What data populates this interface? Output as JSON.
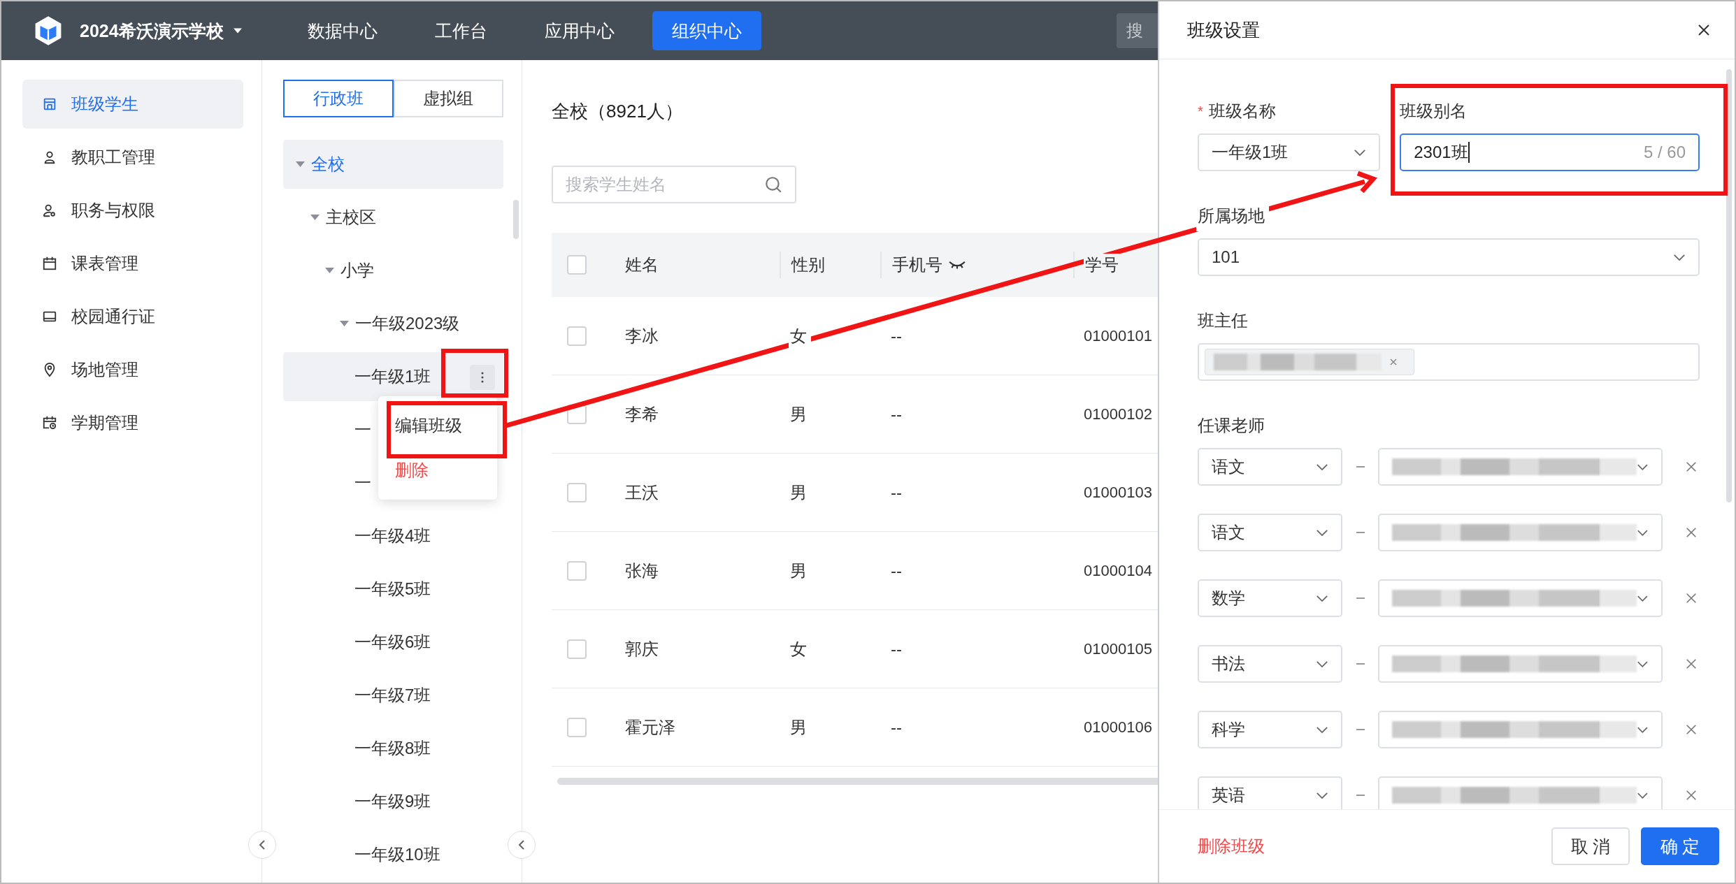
{
  "topbar": {
    "school": "2024希沃演示学校",
    "nav": [
      {
        "label": "数据中心",
        "selected": false
      },
      {
        "label": "工作台",
        "selected": false
      },
      {
        "label": "应用中心",
        "selected": false
      },
      {
        "label": "组织中心",
        "selected": true
      }
    ],
    "search": {
      "placeholder": "搜"
    }
  },
  "sidebar": {
    "items": [
      {
        "label": "班级学生",
        "kind": "tray",
        "selected": true
      },
      {
        "label": "教职工管理",
        "kind": "person",
        "selected": false
      },
      {
        "label": "职务与权限",
        "kind": "person-key",
        "selected": false
      },
      {
        "label": "课表管理",
        "kind": "calendar",
        "selected": false
      },
      {
        "label": "校园通行证",
        "kind": "card",
        "selected": false
      },
      {
        "label": "场地管理",
        "kind": "pin",
        "selected": false
      },
      {
        "label": "学期管理",
        "kind": "calendar-clock",
        "selected": false
      }
    ]
  },
  "tree": {
    "tabs": [
      {
        "label": "行政班",
        "selected": true
      },
      {
        "label": "虚拟组",
        "selected": false
      }
    ],
    "nodes": [
      {
        "label": "全校",
        "selected": true,
        "hovered": false,
        "expanded": true,
        "children": [
          {
            "label": "主校区",
            "selected": false,
            "hovered": false,
            "expanded": true,
            "children": [
              {
                "label": "小学",
                "selected": false,
                "hovered": false,
                "expanded": true,
                "children": [
                  {
                    "label": "一年级2023级",
                    "selected": false,
                    "hovered": false,
                    "expanded": true,
                    "children": [
                      {
                        "label": "一年级1班",
                        "selected": false,
                        "hovered": true
                      },
                      {
                        "label": "一",
                        "selected": false,
                        "hovered": false
                      },
                      {
                        "label": "一",
                        "selected": false,
                        "hovered": false
                      },
                      {
                        "label": "一年级4班",
                        "selected": false,
                        "hovered": false
                      },
                      {
                        "label": "一年级5班",
                        "selected": false,
                        "hovered": false
                      },
                      {
                        "label": "一年级6班",
                        "selected": false,
                        "hovered": false
                      },
                      {
                        "label": "一年级7班",
                        "selected": false,
                        "hovered": false
                      },
                      {
                        "label": "一年级8班",
                        "selected": false,
                        "hovered": false
                      },
                      {
                        "label": "一年级9班",
                        "selected": false,
                        "hovered": false
                      },
                      {
                        "label": "一年级10班",
                        "selected": false,
                        "hovered": false
                      }
                    ]
                  }
                ]
              }
            ]
          }
        ]
      }
    ]
  },
  "context_menu": {
    "items": [
      {
        "label": "编辑班级",
        "kind": "normal"
      },
      {
        "label": "删除",
        "kind": "danger"
      }
    ]
  },
  "main": {
    "title": "全校（8921人）",
    "search": {
      "placeholder": "搜索学生姓名"
    },
    "table": {
      "all_checked": false,
      "columns": [
        "姓名",
        "性别",
        "手机号",
        "学号"
      ],
      "rows": [
        {
          "checked": false,
          "cells": [
            "李冰",
            "女",
            "--",
            "01000101"
          ]
        },
        {
          "checked": false,
          "cells": [
            "李希",
            "男",
            "--",
            "01000102"
          ]
        },
        {
          "checked": false,
          "cells": [
            "王沃",
            "男",
            "--",
            "01000103"
          ]
        },
        {
          "checked": false,
          "cells": [
            "张海",
            "男",
            "--",
            "01000104"
          ]
        },
        {
          "checked": false,
          "cells": [
            "郭庆",
            "女",
            "--",
            "01000105"
          ]
        },
        {
          "checked": false,
          "cells": [
            "霍元泽",
            "男",
            "--",
            "01000106"
          ]
        }
      ]
    }
  },
  "drawer": {
    "title": "班级设置",
    "required_sign": "*",
    "class_name": {
      "label": "班级名称",
      "required": true,
      "value": "一年级1班"
    },
    "alias": {
      "label": "班级别名",
      "value": "2301班",
      "counter": "5 / 60",
      "focused": true
    },
    "venue": {
      "label": "所属场地",
      "value": "101"
    },
    "head_teacher": {
      "label": "班主任"
    },
    "teachers": {
      "label": "任课老师",
      "rows": [
        {
          "subject": "语文"
        },
        {
          "subject": "语文"
        },
        {
          "subject": "数学"
        },
        {
          "subject": "书法"
        },
        {
          "subject": "科学"
        },
        {
          "subject": "英语"
        }
      ]
    },
    "footer": {
      "delete": "删除班级",
      "cancel": "取 消",
      "confirm": "确 定"
    }
  }
}
